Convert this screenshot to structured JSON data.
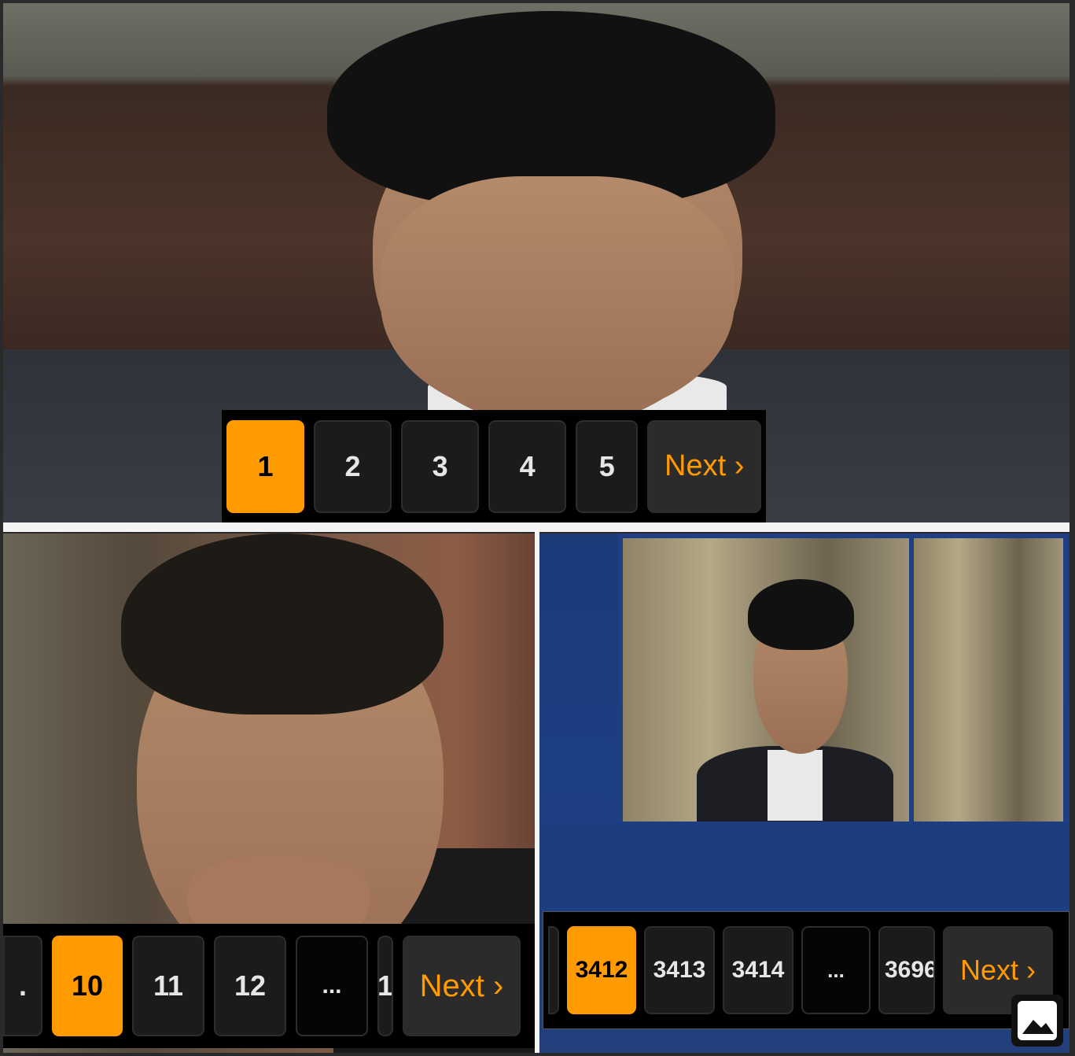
{
  "panels": {
    "top": {
      "pagination": {
        "pages": [
          "1",
          "2",
          "3",
          "4",
          "5"
        ],
        "active": "1",
        "next_label": "Next ›"
      }
    },
    "bottom_left": {
      "pagination": {
        "leading_fragment": ".",
        "pages": [
          "10",
          "11",
          "12",
          "..."
        ],
        "trailing_fragment": "1",
        "active": "10",
        "next_label": "Next ›"
      }
    },
    "bottom_right": {
      "pagination": {
        "pages": [
          "3412",
          "3413",
          "3414",
          "...",
          "3696"
        ],
        "active": "3412",
        "next_label": "Next ›"
      }
    }
  },
  "colors": {
    "accent": "#ff9a00",
    "button_bg": "#1b1b1b",
    "bar_bg": "#000000"
  },
  "icons": {
    "corner": "image-icon"
  }
}
